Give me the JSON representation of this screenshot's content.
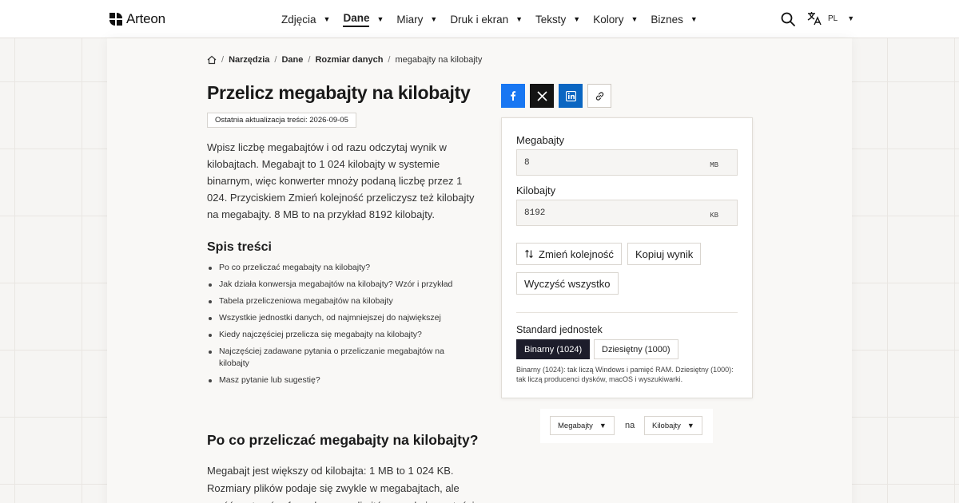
{
  "brand": {
    "name": "Arteon"
  },
  "nav": {
    "items": [
      {
        "label": "Zdjęcia",
        "active": false
      },
      {
        "label": "Dane",
        "active": true
      },
      {
        "label": "Miary",
        "active": false
      },
      {
        "label": "Druk i ekran",
        "active": false
      },
      {
        "label": "Teksty",
        "active": false
      },
      {
        "label": "Kolory",
        "active": false
      },
      {
        "label": "Biznes",
        "active": false
      }
    ],
    "language": "PL"
  },
  "breadcrumb": {
    "items": [
      "Narzędzia",
      "Dane",
      "Rozmiar danych"
    ],
    "current": "megabajty na kilobajty"
  },
  "page": {
    "title": "Przelicz megabajty na kilobajty",
    "updated": "Ostatnia aktualizacja treści: 2026-09-05",
    "intro": "Wpisz liczbę megabajtów i od razu odczytaj wynik w kilobajtach. Megabajt to 1 024 kilobajty w systemie binarnym, więc konwerter mnoży podaną liczbę przez 1 024. Przyciskiem Zmień kolejność przeliczysz też kilobajty na megabajty. 8 MB to na przykład 8192 kilobajty."
  },
  "toc": {
    "title": "Spis treści",
    "items": [
      "Po co przeliczać megabajty na kilobajty?",
      "Jak działa konwersja megabajtów na kilobajty? Wzór i przykład",
      "Tabela przeliczeniowa megabajtów na kilobajty",
      "Wszystkie jednostki danych, od najmniejszej do największej",
      "Kiedy najczęściej przelicza się megabajty na kilobajty?",
      "Najczęściej zadawane pytania o przeliczanie megabajtów na kilobajty",
      "Masz pytanie lub sugestię?"
    ]
  },
  "section": {
    "heading": "Po co przeliczać megabajty na kilobajty?",
    "paragraph": "Megabajt jest większy od kilobajta: 1 MB to 1 024 KB. Rozmiary plików podaje się zwykle w megabajtach, ale część systemów, formularzy czy limitów oczekuje wartości"
  },
  "share": {
    "icons": [
      "facebook-icon",
      "x-icon",
      "linkedin-icon",
      "link-icon"
    ],
    "colors": {
      "facebook": "#1877f2",
      "x": "#141414",
      "linkedin": "#0a66c2"
    }
  },
  "converter": {
    "from": {
      "label": "Megabajty",
      "value": "8",
      "unit": "MB"
    },
    "to": {
      "label": "Kilobajty",
      "value": "8192",
      "unit": "KB"
    },
    "buttons": {
      "swap": "Zmień kolejność",
      "copy": "Kopiuj wynik",
      "clear": "Wyczyść wszystko"
    },
    "standard": {
      "label": "Standard jednostek",
      "options": [
        "Binarny (1024)",
        "Dziesiętny (1000)"
      ],
      "selected": "Binarny (1024)",
      "note": "Binarny (1024): tak liczą Windows i pamięć RAM. Dziesiętny (1000): tak liczą producenci dysków, macOS i wyszukiwarki."
    }
  },
  "unit_selector": {
    "from": "Megabajty",
    "connector": "na",
    "to": "Kilobajty"
  }
}
